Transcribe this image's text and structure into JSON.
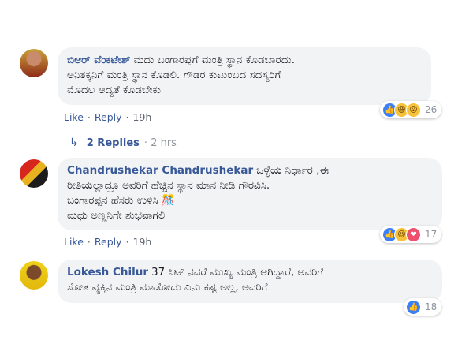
{
  "comments": [
    {
      "author": "ಬಿಆರ್ ವೆಂಕಟೇಶ್",
      "text_lines": [
        "ಮದು ಬಂಗಾರಪ್ಪಗೆ ಮಂತ್ರಿ ಸ್ಥಾನ ಕೊಡಬಾರದು.",
        "ಅನಿತಕ್ಕನಿಗೆ ಮಂತ್ರಿ ಸ್ಥಾನ ಕೊಡಲಿ. ಗೌಡರ ಕುಟುಂಬದ ಸದಸ್ಯರಿಗೆ",
        "ಮೊದಲ ಆದ್ಯತೆ ಕೊಡಬೇಕು"
      ],
      "like": "Like",
      "reply": "Reply",
      "time": "19h",
      "reaction_count": "26",
      "reactions": [
        "like-icon",
        "haha-icon",
        "wow-icon"
      ]
    },
    {
      "author": "Chandrushekar Chandrushekar",
      "text_lines": [
        "ಒಳ್ಳೆಯ ನಿರ್ಧಾರ ,ಈ",
        "ರೀತಿಯಲ್ಲಾದ್ರೂ ಅವರಿಗೆ ಹೆಚ್ಚಿನ ಸ್ಥಾನ ಮಾನ ನೀಡಿ ಗೌರವಿಸಿ.",
        "ಬಂಗಾರಪ್ಪನ ಹೆಸರು ಉಳಿಸಿ 🎊",
        "ಮಧು ಅಣ್ಣನಿಗೇ ಶುಭವಾಗಲಿ"
      ],
      "like": "Like",
      "reply": "Reply",
      "time": "19h",
      "reaction_count": "17",
      "reactions": [
        "like-icon",
        "haha-icon",
        "love-icon"
      ]
    },
    {
      "author": "Lokesh Chilur",
      "text_lines": [
        "37 ಸಿಟ್ ನವರೆ ಮುಖ್ಯ ಮಂತ್ರಿ ಆಗಿದ್ದಾರೆ, ಅವರಿಗೆ",
        "ಸೋತ ವ್ಯಕ್ತಿನ ಮಂತ್ರಿ ಮಾಡೋದು ಎನು ಕಷ್ಟ ಅಲ್ಲ, ಅವರಿಗೆ"
      ],
      "reaction_count": "18",
      "reactions": [
        "like-icon"
      ]
    }
  ],
  "replies_link": {
    "label": "2 Replies",
    "separator": "·",
    "time": "2 hrs"
  },
  "separator": "·",
  "colors": {
    "link": "#385898",
    "bubble": "#f2f3f5",
    "meta": "#606770"
  }
}
